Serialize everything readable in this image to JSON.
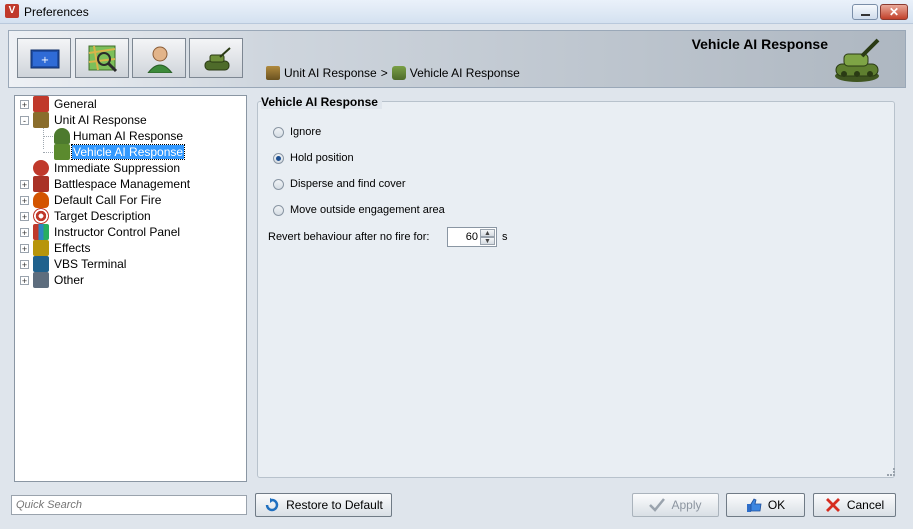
{
  "window": {
    "title": "Preferences",
    "app_icon": "vbs-app-icon"
  },
  "toolbar": {
    "buttons": [
      {
        "name": "display-settings-button",
        "icon": "display-icon"
      },
      {
        "name": "map-search-button",
        "icon": "map-search-icon"
      },
      {
        "name": "user-profile-button",
        "icon": "user-icon"
      },
      {
        "name": "ai-settings-button",
        "icon": "tank-icon"
      }
    ]
  },
  "header": {
    "title": "Vehicle AI Response",
    "breadcrumb": {
      "parent": "Unit AI Response",
      "separator": ">",
      "current": "Vehicle AI Response"
    }
  },
  "tree": {
    "items": [
      {
        "label": "General",
        "expander": "+",
        "icon": "tools-icon",
        "color": "#c0392b"
      },
      {
        "label": "Unit AI Response",
        "expander": "-",
        "icon": "unit-icon",
        "color": "#8a6d2c"
      },
      {
        "label": "Human AI Response",
        "icon": "human-icon",
        "color": "#4d7a2e"
      },
      {
        "label": "Vehicle AI Response",
        "icon": "tank-icon",
        "color": "#5b8a2e",
        "selected": true
      },
      {
        "label": "Immediate Suppression",
        "icon": "suppression-icon",
        "color": "#c0392b"
      },
      {
        "label": "Battlespace Management",
        "expander": "+",
        "icon": "map-icon",
        "color": "#a93226"
      },
      {
        "label": "Default Call For Fire",
        "expander": "+",
        "icon": "fire-icon",
        "color": "#d35400"
      },
      {
        "label": "Target Description",
        "expander": "+",
        "icon": "target-icon",
        "color": "#c0392b"
      },
      {
        "label": "Instructor Control Panel",
        "expander": "+",
        "icon": "control-panel-icon",
        "color": "#2e86c1"
      },
      {
        "label": "Effects",
        "expander": "+",
        "icon": "effects-icon",
        "color": "#b7950b"
      },
      {
        "label": "VBS Terminal",
        "expander": "+",
        "icon": "terminal-icon",
        "color": "#1f618d"
      },
      {
        "label": "Other",
        "expander": "+",
        "icon": "other-icon",
        "color": "#5d6d7e"
      }
    ]
  },
  "panel": {
    "title": "Vehicle AI Response",
    "options": [
      {
        "label": "Ignore",
        "checked": false
      },
      {
        "label": "Hold position",
        "checked": true
      },
      {
        "label": "Disperse and find cover",
        "checked": false
      },
      {
        "label": "Move outside engagement area",
        "checked": false
      }
    ],
    "revert_label": "Revert behaviour after no fire for:",
    "revert_value": "60",
    "revert_unit": "s"
  },
  "footer": {
    "search_placeholder": "Quick Search",
    "restore_label": "Restore to Default",
    "apply_label": "Apply",
    "ok_label": "OK",
    "cancel_label": "Cancel"
  },
  "colors": {
    "selection": "#3399ff",
    "window_bg": "#dfe5ec"
  }
}
